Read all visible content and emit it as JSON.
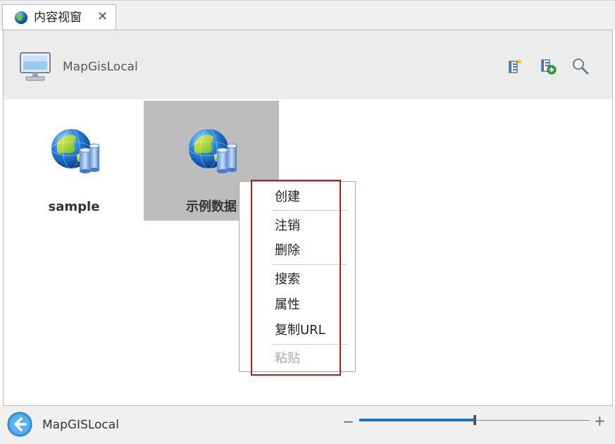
{
  "tab": {
    "title": "内容视窗",
    "close_glyph": "✕",
    "icon": "globe-icon"
  },
  "header": {
    "location": "MapGisLocal",
    "location_icon": "computer-monitor-icon",
    "tools": [
      {
        "name": "new-catalog-icon"
      },
      {
        "name": "add-data-icon"
      },
      {
        "name": "search-icon"
      }
    ]
  },
  "items": [
    {
      "label": "sample",
      "icon": "gis-database-globe-icon",
      "selected": false
    },
    {
      "label": "示例数据",
      "icon": "gis-database-globe-icon",
      "selected": true
    }
  ],
  "context_menu": {
    "groups": [
      [
        {
          "label": "创建",
          "enabled": true
        }
      ],
      [
        {
          "label": "注销",
          "enabled": true
        },
        {
          "label": "删除",
          "enabled": true
        }
      ],
      [
        {
          "label": "搜索",
          "enabled": true
        },
        {
          "label": "属性",
          "enabled": true
        },
        {
          "label": "复制URL",
          "enabled": true
        }
      ],
      [
        {
          "label": "粘贴",
          "enabled": false
        }
      ]
    ],
    "highlight_color": "#b01f24"
  },
  "status_bar": {
    "path": "MapGISLocal",
    "back_icon": "back-arrow-icon",
    "zoom_minus": "−",
    "zoom_plus": "+",
    "zoom_level_fraction": 0.5
  },
  "colors": {
    "selection": "#bdbdbd",
    "header_bg": "#ececec",
    "accent": "#1e73c8"
  }
}
